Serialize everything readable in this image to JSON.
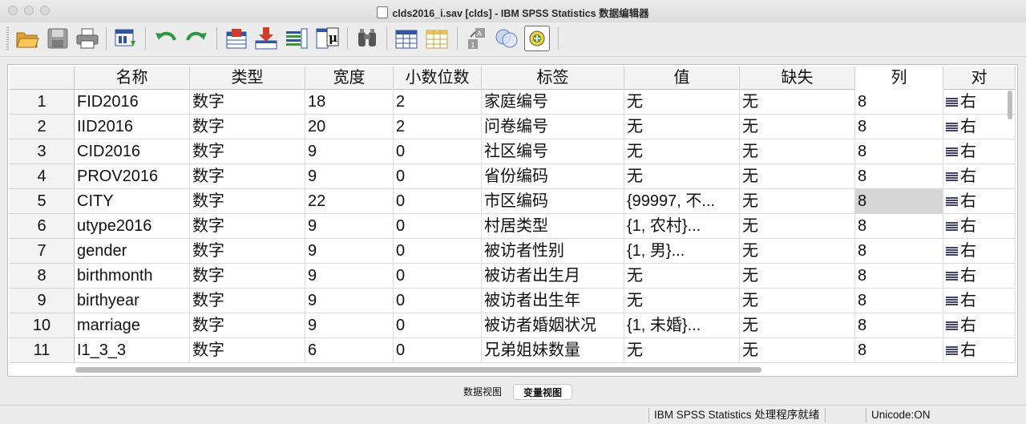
{
  "window": {
    "title": "clds2016_i.sav [clds] - IBM SPSS Statistics 数据编辑器"
  },
  "toolbar": {
    "buttons": [
      "open-icon",
      "save-icon",
      "print-icon",
      "recall-dialog-icon",
      "undo-icon",
      "redo-icon",
      "goto-case-icon",
      "goto-variable-icon",
      "variables-icon",
      "run-descriptive-icon",
      "find-icon",
      "insert-cases-icon",
      "insert-variable-icon",
      "split-file-icon",
      "select-cases-icon",
      "value-labels-icon",
      "use-sets-icon"
    ]
  },
  "grid": {
    "columns": [
      "名称",
      "类型",
      "宽度",
      "小数位数",
      "标签",
      "值",
      "缺失",
      "列",
      "对"
    ],
    "active_column": "列",
    "rows": [
      {
        "num": "1",
        "name": "FID2016",
        "type": "数字",
        "width": "18",
        "decimals": "2",
        "label": "家庭编号",
        "values": "无",
        "missing": "无",
        "columns": "8",
        "align": "右"
      },
      {
        "num": "2",
        "name": "IID2016",
        "type": "数字",
        "width": "20",
        "decimals": "2",
        "label": "问卷编号",
        "values": "无",
        "missing": "无",
        "columns": "8",
        "align": "右"
      },
      {
        "num": "3",
        "name": "CID2016",
        "type": "数字",
        "width": "9",
        "decimals": "0",
        "label": "社区编号",
        "values": "无",
        "missing": "无",
        "columns": "8",
        "align": "右"
      },
      {
        "num": "4",
        "name": "PROV2016",
        "type": "数字",
        "width": "9",
        "decimals": "0",
        "label": "省份编码",
        "values": "无",
        "missing": "无",
        "columns": "8",
        "align": "右"
      },
      {
        "num": "5",
        "name": "CITY",
        "type": "数字",
        "width": "22",
        "decimals": "0",
        "label": "市区编码",
        "values": "{99997, 不...",
        "missing": "无",
        "columns": "8",
        "align": "右"
      },
      {
        "num": "6",
        "name": "utype2016",
        "type": "数字",
        "width": "9",
        "decimals": "0",
        "label": "村居类型",
        "values": "{1, 农村}...",
        "missing": "无",
        "columns": "8",
        "align": "右"
      },
      {
        "num": "7",
        "name": "gender",
        "type": "数字",
        "width": "9",
        "decimals": "0",
        "label": "被访者性别",
        "values": "{1, 男}...",
        "missing": "无",
        "columns": "8",
        "align": "右"
      },
      {
        "num": "8",
        "name": "birthmonth",
        "type": "数字",
        "width": "9",
        "decimals": "0",
        "label": "被访者出生月",
        "values": "无",
        "missing": "无",
        "columns": "8",
        "align": "右"
      },
      {
        "num": "9",
        "name": "birthyear",
        "type": "数字",
        "width": "9",
        "decimals": "0",
        "label": "被访者出生年",
        "values": "无",
        "missing": "无",
        "columns": "8",
        "align": "右"
      },
      {
        "num": "10",
        "name": "marriage",
        "type": "数字",
        "width": "9",
        "decimals": "0",
        "label": "被访者婚姻状况",
        "values": "{1, 未婚}...",
        "missing": "无",
        "columns": "8",
        "align": "右"
      },
      {
        "num": "11",
        "name": "I1_3_3",
        "type": "数字",
        "width": "6",
        "decimals": "0",
        "label": "兄弟姐妹数量",
        "values": "无",
        "missing": "无",
        "columns": "8",
        "align": "右"
      }
    ],
    "selected_cell": {
      "row": "5",
      "column": "列"
    }
  },
  "tabs": [
    {
      "label": "数据视图",
      "active": false
    },
    {
      "label": "变量视图",
      "active": true
    }
  ],
  "status": {
    "processor": "IBM SPSS Statistics 处理程序就绪",
    "unicode": "Unicode:ON"
  }
}
